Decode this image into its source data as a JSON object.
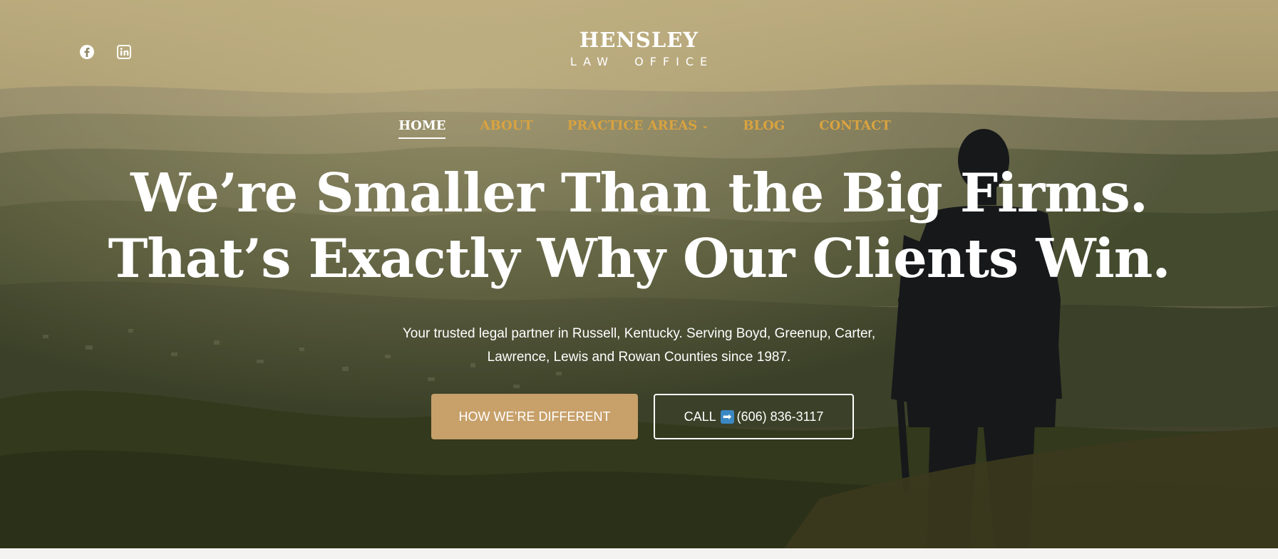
{
  "social": {
    "facebook_icon": "facebook-icon",
    "linkedin_icon": "linkedin-icon"
  },
  "logo": {
    "name": "HENSLEY",
    "sub": "LAW OFFICE"
  },
  "nav": {
    "items": [
      {
        "label": "HOME",
        "active": true
      },
      {
        "label": "ABOUT"
      },
      {
        "label": "PRACTICE AREAS"
      },
      {
        "label": "BLOG"
      },
      {
        "label": "CONTACT"
      }
    ]
  },
  "hero": {
    "headline_line1": "We’re Smaller Than the Big Firms.",
    "headline_line2": "That’s Exactly Why Our Clients Win.",
    "subtitle_line1": "Your trusted legal partner in Russell, Kentucky. Serving Boyd, Greenup, Carter,",
    "subtitle_line2": "Lawrence, Lewis and Rowan Counties since 1987.",
    "primary_button": "HOW WE’RE DIFFERENT",
    "call_prefix": "CALL",
    "call_arrow": "➡",
    "call_number": "(606) 836-3117"
  },
  "colors": {
    "accent_nav": "#d9a340",
    "button_gold": "#c7a06a",
    "arrow_blue": "#3b88c3"
  }
}
